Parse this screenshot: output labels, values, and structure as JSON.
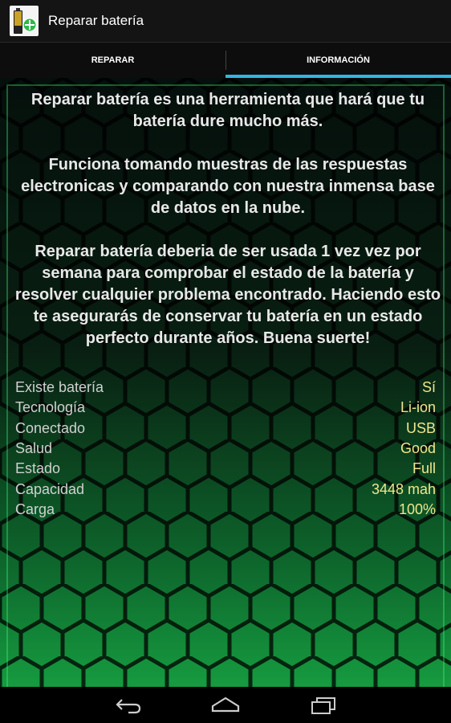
{
  "app": {
    "title": "Reparar batería",
    "icon": "battery-repair-icon"
  },
  "tabs": [
    {
      "label": "REPARAR",
      "active": false
    },
    {
      "label": "INFORMACIÓN",
      "active": true
    }
  ],
  "description": [
    "Reparar batería es una herramienta que hará que tu batería dure mucho más.",
    "Funciona tomando muestras de las respuestas electronicas y comparando con nuestra inmensa base de datos en la nube.",
    "Reparar batería deberia de ser usada 1 vez vez por semana para comprobar el estado de la batería y resolver cualquier problema encontrado. Haciendo esto te asegurarás de conservar tu batería en un estado perfecto durante años. Buena suerte!"
  ],
  "battery_info": [
    {
      "label": "Existe batería",
      "value": "Sí"
    },
    {
      "label": "Tecnología",
      "value": "Li-ion"
    },
    {
      "label": "Conectado",
      "value": "USB"
    },
    {
      "label": "Salud",
      "value": "Good"
    },
    {
      "label": "Estado",
      "value": "Full"
    },
    {
      "label": "Capacidad",
      "value": "3448 mah"
    },
    {
      "label": "Carga",
      "value": "100%"
    }
  ],
  "navbar": {
    "back": "back-icon",
    "home": "home-icon",
    "recents": "recents-icon"
  },
  "colors": {
    "tab_indicator": "#33b5e5",
    "value_text": "#f0e68c",
    "accent_green": "#1aa04a"
  }
}
